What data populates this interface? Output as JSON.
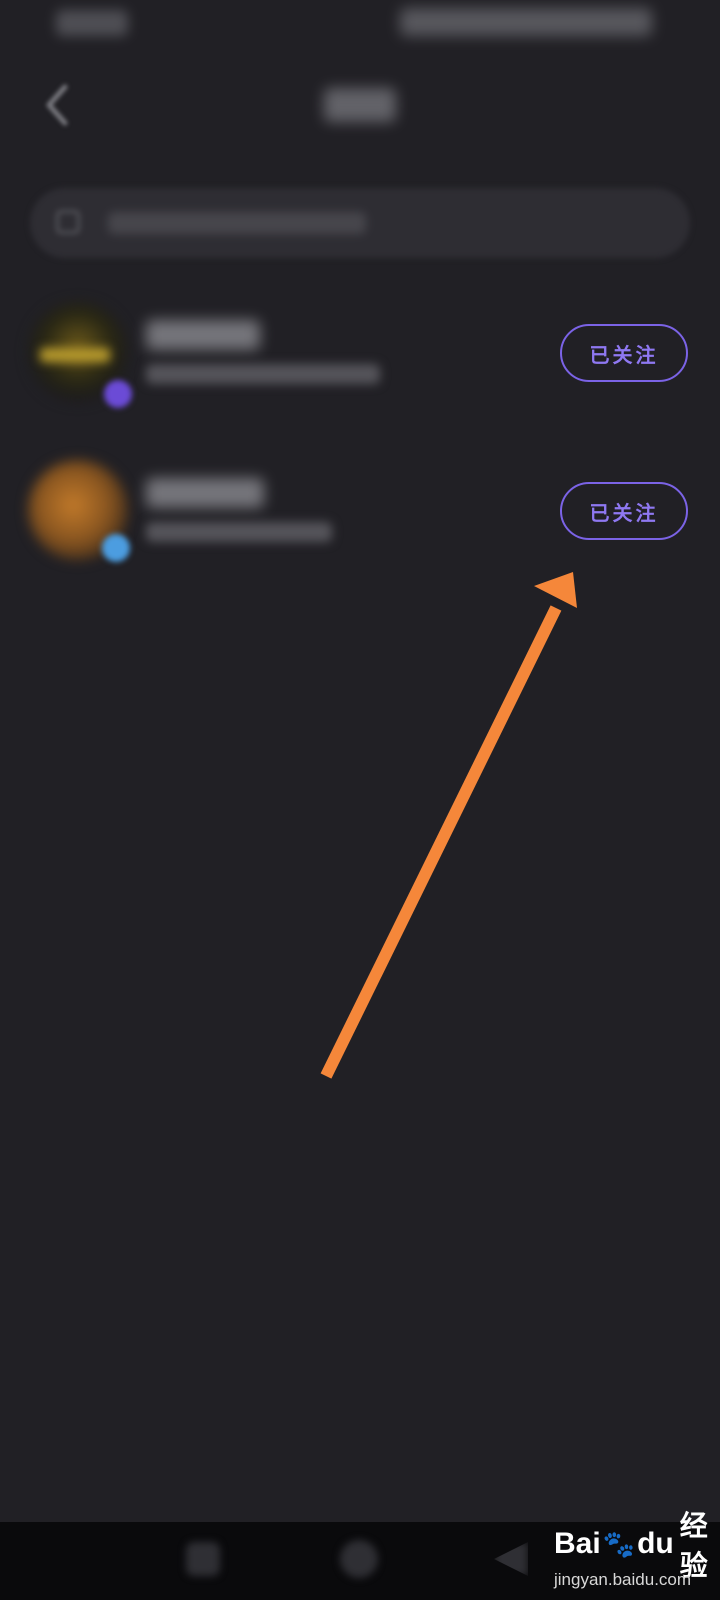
{
  "list": {
    "items": [
      {
        "follow_label": "已关注"
      },
      {
        "follow_label": "已关注"
      }
    ]
  },
  "annotation": {
    "arrow_color": "#F5873A"
  },
  "watermark": {
    "logo_left": "Bai",
    "logo_right": "du",
    "brand_cn": "经验",
    "url": "jingyan.baidu.com"
  },
  "colors": {
    "background": "#212025",
    "accent": "#7B63E6"
  }
}
